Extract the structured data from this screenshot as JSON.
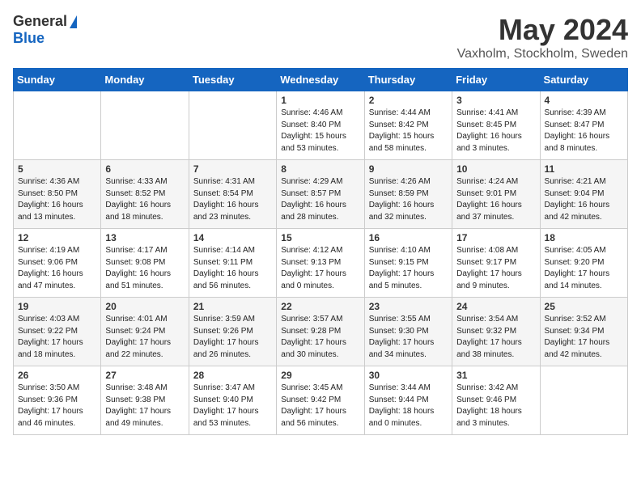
{
  "header": {
    "logo_general": "General",
    "logo_blue": "Blue",
    "month": "May 2024",
    "location": "Vaxholm, Stockholm, Sweden"
  },
  "weekdays": [
    "Sunday",
    "Monday",
    "Tuesday",
    "Wednesday",
    "Thursday",
    "Friday",
    "Saturday"
  ],
  "weeks": [
    [
      {
        "day": "",
        "info": ""
      },
      {
        "day": "",
        "info": ""
      },
      {
        "day": "",
        "info": ""
      },
      {
        "day": "1",
        "info": "Sunrise: 4:46 AM\nSunset: 8:40 PM\nDaylight: 15 hours\nand 53 minutes."
      },
      {
        "day": "2",
        "info": "Sunrise: 4:44 AM\nSunset: 8:42 PM\nDaylight: 15 hours\nand 58 minutes."
      },
      {
        "day": "3",
        "info": "Sunrise: 4:41 AM\nSunset: 8:45 PM\nDaylight: 16 hours\nand 3 minutes."
      },
      {
        "day": "4",
        "info": "Sunrise: 4:39 AM\nSunset: 8:47 PM\nDaylight: 16 hours\nand 8 minutes."
      }
    ],
    [
      {
        "day": "5",
        "info": "Sunrise: 4:36 AM\nSunset: 8:50 PM\nDaylight: 16 hours\nand 13 minutes."
      },
      {
        "day": "6",
        "info": "Sunrise: 4:33 AM\nSunset: 8:52 PM\nDaylight: 16 hours\nand 18 minutes."
      },
      {
        "day": "7",
        "info": "Sunrise: 4:31 AM\nSunset: 8:54 PM\nDaylight: 16 hours\nand 23 minutes."
      },
      {
        "day": "8",
        "info": "Sunrise: 4:29 AM\nSunset: 8:57 PM\nDaylight: 16 hours\nand 28 minutes."
      },
      {
        "day": "9",
        "info": "Sunrise: 4:26 AM\nSunset: 8:59 PM\nDaylight: 16 hours\nand 32 minutes."
      },
      {
        "day": "10",
        "info": "Sunrise: 4:24 AM\nSunset: 9:01 PM\nDaylight: 16 hours\nand 37 minutes."
      },
      {
        "day": "11",
        "info": "Sunrise: 4:21 AM\nSunset: 9:04 PM\nDaylight: 16 hours\nand 42 minutes."
      }
    ],
    [
      {
        "day": "12",
        "info": "Sunrise: 4:19 AM\nSunset: 9:06 PM\nDaylight: 16 hours\nand 47 minutes."
      },
      {
        "day": "13",
        "info": "Sunrise: 4:17 AM\nSunset: 9:08 PM\nDaylight: 16 hours\nand 51 minutes."
      },
      {
        "day": "14",
        "info": "Sunrise: 4:14 AM\nSunset: 9:11 PM\nDaylight: 16 hours\nand 56 minutes."
      },
      {
        "day": "15",
        "info": "Sunrise: 4:12 AM\nSunset: 9:13 PM\nDaylight: 17 hours\nand 0 minutes."
      },
      {
        "day": "16",
        "info": "Sunrise: 4:10 AM\nSunset: 9:15 PM\nDaylight: 17 hours\nand 5 minutes."
      },
      {
        "day": "17",
        "info": "Sunrise: 4:08 AM\nSunset: 9:17 PM\nDaylight: 17 hours\nand 9 minutes."
      },
      {
        "day": "18",
        "info": "Sunrise: 4:05 AM\nSunset: 9:20 PM\nDaylight: 17 hours\nand 14 minutes."
      }
    ],
    [
      {
        "day": "19",
        "info": "Sunrise: 4:03 AM\nSunset: 9:22 PM\nDaylight: 17 hours\nand 18 minutes."
      },
      {
        "day": "20",
        "info": "Sunrise: 4:01 AM\nSunset: 9:24 PM\nDaylight: 17 hours\nand 22 minutes."
      },
      {
        "day": "21",
        "info": "Sunrise: 3:59 AM\nSunset: 9:26 PM\nDaylight: 17 hours\nand 26 minutes."
      },
      {
        "day": "22",
        "info": "Sunrise: 3:57 AM\nSunset: 9:28 PM\nDaylight: 17 hours\nand 30 minutes."
      },
      {
        "day": "23",
        "info": "Sunrise: 3:55 AM\nSunset: 9:30 PM\nDaylight: 17 hours\nand 34 minutes."
      },
      {
        "day": "24",
        "info": "Sunrise: 3:54 AM\nSunset: 9:32 PM\nDaylight: 17 hours\nand 38 minutes."
      },
      {
        "day": "25",
        "info": "Sunrise: 3:52 AM\nSunset: 9:34 PM\nDaylight: 17 hours\nand 42 minutes."
      }
    ],
    [
      {
        "day": "26",
        "info": "Sunrise: 3:50 AM\nSunset: 9:36 PM\nDaylight: 17 hours\nand 46 minutes."
      },
      {
        "day": "27",
        "info": "Sunrise: 3:48 AM\nSunset: 9:38 PM\nDaylight: 17 hours\nand 49 minutes."
      },
      {
        "day": "28",
        "info": "Sunrise: 3:47 AM\nSunset: 9:40 PM\nDaylight: 17 hours\nand 53 minutes."
      },
      {
        "day": "29",
        "info": "Sunrise: 3:45 AM\nSunset: 9:42 PM\nDaylight: 17 hours\nand 56 minutes."
      },
      {
        "day": "30",
        "info": "Sunrise: 3:44 AM\nSunset: 9:44 PM\nDaylight: 18 hours\nand 0 minutes."
      },
      {
        "day": "31",
        "info": "Sunrise: 3:42 AM\nSunset: 9:46 PM\nDaylight: 18 hours\nand 3 minutes."
      },
      {
        "day": "",
        "info": ""
      }
    ]
  ]
}
